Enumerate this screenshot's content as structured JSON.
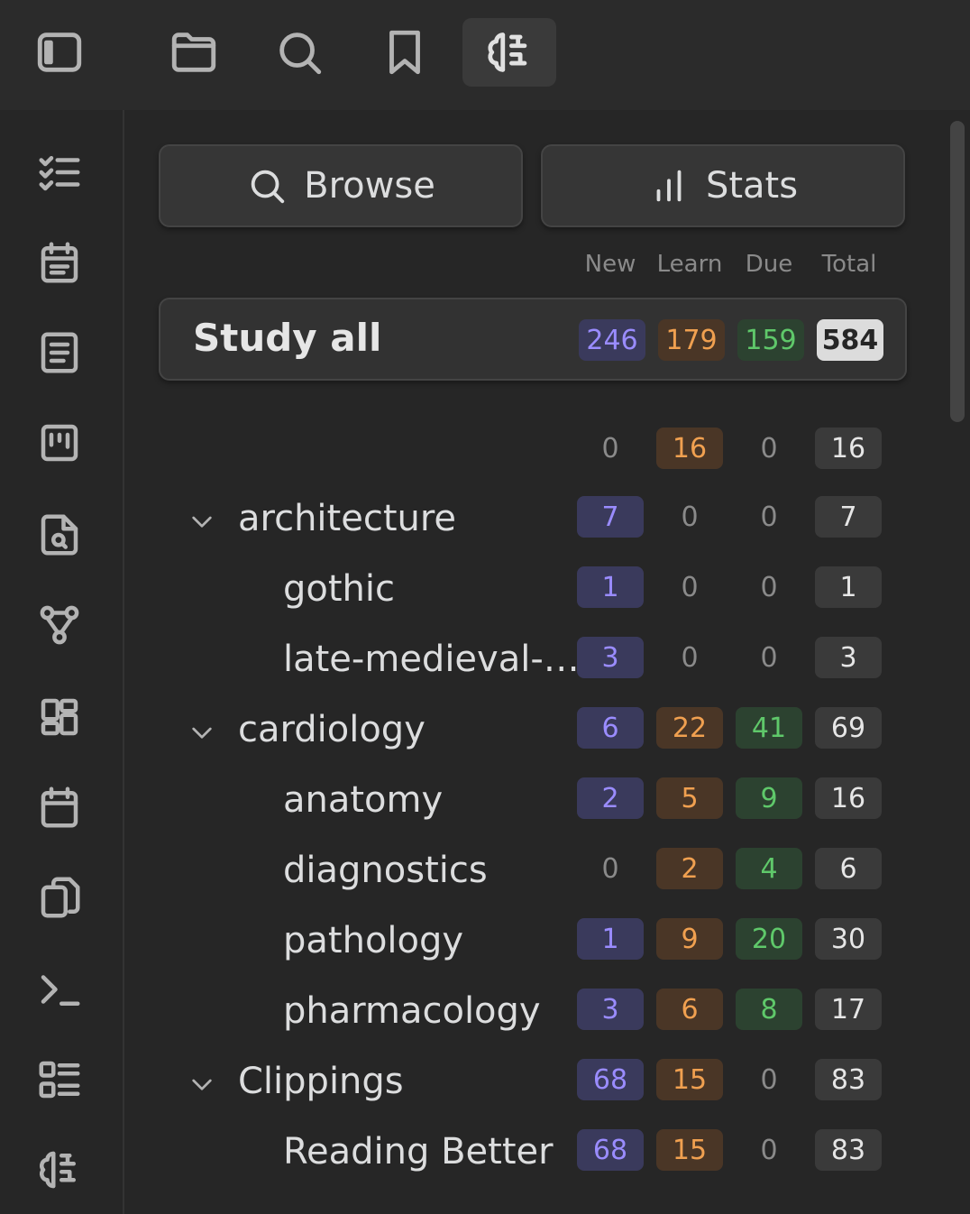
{
  "topbar": {
    "icons": [
      "sidebar-toggle-icon",
      "folder-icon",
      "search-icon",
      "bookmark-icon",
      "brain-icon"
    ],
    "active": "brain-icon"
  },
  "ribbon": {
    "icons": [
      "checklist-icon",
      "calendar-list-icon",
      "note-icon",
      "kanban-icon",
      "file-search-icon",
      "graph-icon",
      "dashboard-icon",
      "calendar-icon",
      "copy-icon",
      "terminal-icon",
      "list-layout-icon",
      "brain-icon"
    ]
  },
  "toolbar": {
    "browse_label": "Browse",
    "stats_label": "Stats"
  },
  "columns": {
    "new": "New",
    "learn": "Learn",
    "due": "Due",
    "total": "Total"
  },
  "study_all": {
    "label": "Study all",
    "new": "246",
    "learn": "179",
    "due": "159",
    "total": "584"
  },
  "decks": [
    {
      "label": "",
      "level": 0,
      "collapsible": false,
      "new": "0",
      "learn": "16",
      "due": "0",
      "total": "16"
    },
    {
      "label": "architecture",
      "level": 0,
      "collapsible": true,
      "new": "7",
      "learn": "0",
      "due": "0",
      "total": "7"
    },
    {
      "label": "gothic",
      "level": 1,
      "collapsible": false,
      "new": "1",
      "learn": "0",
      "due": "0",
      "total": "1"
    },
    {
      "label": "late-medieval-…",
      "level": 1,
      "collapsible": false,
      "new": "3",
      "learn": "0",
      "due": "0",
      "total": "3"
    },
    {
      "label": "cardiology",
      "level": 0,
      "collapsible": true,
      "new": "6",
      "learn": "22",
      "due": "41",
      "total": "69"
    },
    {
      "label": "anatomy",
      "level": 1,
      "collapsible": false,
      "new": "2",
      "learn": "5",
      "due": "9",
      "total": "16"
    },
    {
      "label": "diagnostics",
      "level": 1,
      "collapsible": false,
      "new": "0",
      "learn": "2",
      "due": "4",
      "total": "6"
    },
    {
      "label": "pathology",
      "level": 1,
      "collapsible": false,
      "new": "1",
      "learn": "9",
      "due": "20",
      "total": "30"
    },
    {
      "label": "pharmacology",
      "level": 1,
      "collapsible": false,
      "new": "3",
      "learn": "6",
      "due": "8",
      "total": "17"
    },
    {
      "label": "Clippings",
      "level": 0,
      "collapsible": true,
      "new": "68",
      "learn": "15",
      "due": "0",
      "total": "83"
    },
    {
      "label": "Reading Better",
      "level": 1,
      "collapsible": false,
      "new": "68",
      "learn": "15",
      "due": "0",
      "total": "83"
    }
  ]
}
